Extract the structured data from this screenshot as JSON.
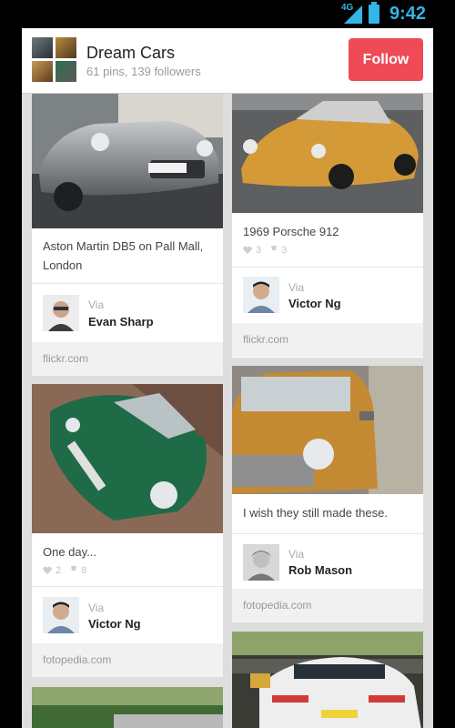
{
  "status_bar": {
    "network": "4G",
    "time": "9:42"
  },
  "board": {
    "title": "Dream Cars",
    "stats": "61 pins, 139 followers",
    "follow_label": "Follow"
  },
  "pins": [
    {
      "description": "Aston Martin DB5 on Pall Mall, London",
      "via": "Via",
      "pinner": "Evan Sharp",
      "source": "flickr.com"
    },
    {
      "description": "1969 Porsche 912",
      "likes": "3",
      "repins": "3",
      "via": "Via",
      "pinner": "Victor Ng",
      "source": "flickr.com"
    },
    {
      "description": "One day...",
      "likes": "2",
      "repins": "8",
      "via": "Via",
      "pinner": "Victor Ng",
      "source": "fotopedia.com"
    },
    {
      "description": "I wish they still made these.",
      "via": "Via",
      "pinner": "Rob Mason",
      "source": "fotopedia.com"
    }
  ],
  "icons": {
    "heart": "heart-icon",
    "repin": "pin-icon",
    "signal": "signal-icon",
    "battery": "battery-icon"
  },
  "colors": {
    "follow": "#ef4b57",
    "status_accent": "#33b5e5"
  }
}
